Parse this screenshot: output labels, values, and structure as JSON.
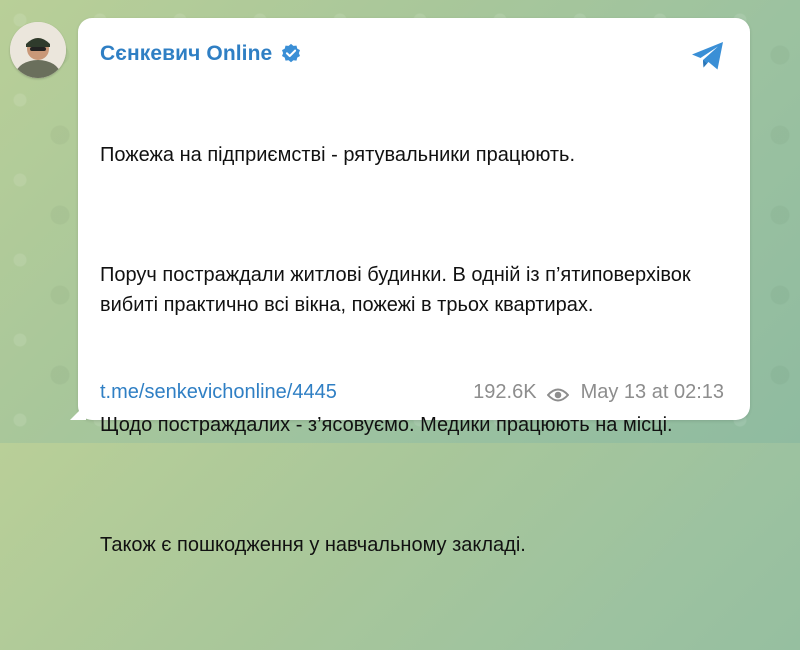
{
  "channel": {
    "name": "Сєнкевич Online"
  },
  "post": {
    "paragraphs": [
      "Пожежа на підприємстві - рятувальники працюють.",
      "Поруч постраждали житлові будинки. В одній із п’ятиповерхівок вибиті практично всі вікна, пожежі в трьох квартирах.",
      "Щодо постраждалих - з’ясовуємо. Медики працюють на місці.",
      "Також є пошкодження у навчальному закладі."
    ],
    "link": "t.me/senkevichonline/4445",
    "views": "192.6K",
    "date": "May 13 at 02:13"
  },
  "icons": {
    "verified": "verified-badge-icon",
    "share": "telegram-share-icon",
    "views": "eye-icon"
  },
  "colors": {
    "accent": "#2f7fc4",
    "share_icon": "#3a8fd6",
    "meta_text": "#8d8d8d"
  }
}
